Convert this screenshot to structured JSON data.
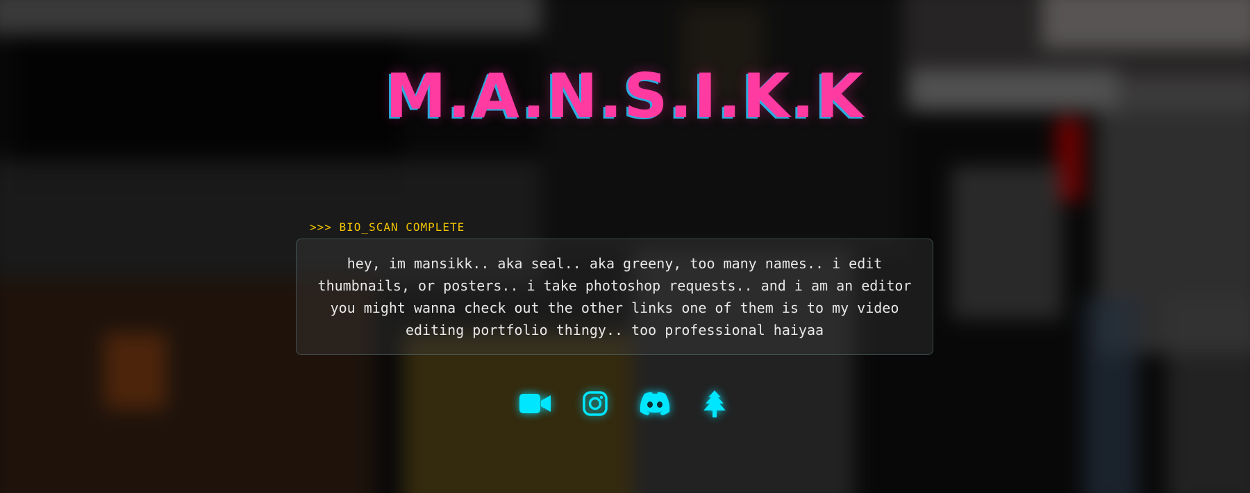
{
  "profile": {
    "name": "M.A.N.S.I.K.K",
    "scan_label": ">>> BIO_SCAN COMPLETE",
    "bio": "hey, im mansikk.. aka seal.. aka greeny, too many names.. i edit thumbnails, or posters.. i take photoshop requests.. and i am an editor you might wanna check out the other links one of them is to my video editing portfolio thingy.. too professional haiyaa"
  },
  "socials": [
    {
      "icon": "video-camera-icon"
    },
    {
      "icon": "instagram-icon"
    },
    {
      "icon": "discord-icon"
    },
    {
      "icon": "linktree-icon"
    }
  ],
  "colors": {
    "title": "#ff3aa0",
    "title_shadow": "#28c8ff",
    "scan_label": "#f2c400",
    "icons": "#00e6ff",
    "bio_text": "#e8e8e8"
  }
}
